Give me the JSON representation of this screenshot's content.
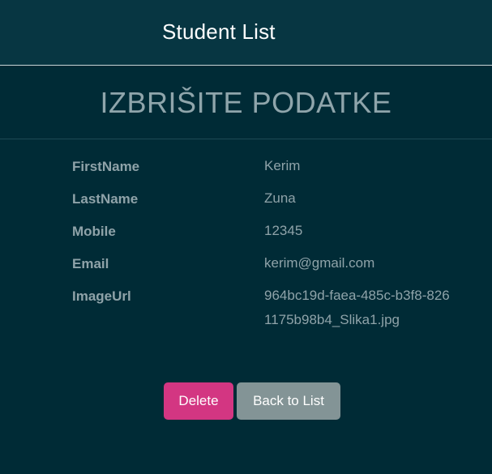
{
  "navbar": {
    "brand": "Student List"
  },
  "page": {
    "title": "IZBRIŠITE PODATKE"
  },
  "details": [
    {
      "label": "FirstName",
      "value": "Kerim"
    },
    {
      "label": "LastName",
      "value": "Zuna"
    },
    {
      "label": "Mobile",
      "value": "12345"
    },
    {
      "label": "Email",
      "value": "kerim@gmail.com"
    },
    {
      "label": "ImageUrl",
      "value": "964bc19d-faea-485c-b3f8-8261175b98b4_Slika1.jpg"
    }
  ],
  "actions": {
    "delete_label": "Delete",
    "back_label": "Back to List"
  },
  "colors": {
    "background": "#002b36",
    "navbar": "#073642",
    "delete": "#d33682",
    "back": "#839496",
    "text_muted": "#8fa3a9"
  }
}
